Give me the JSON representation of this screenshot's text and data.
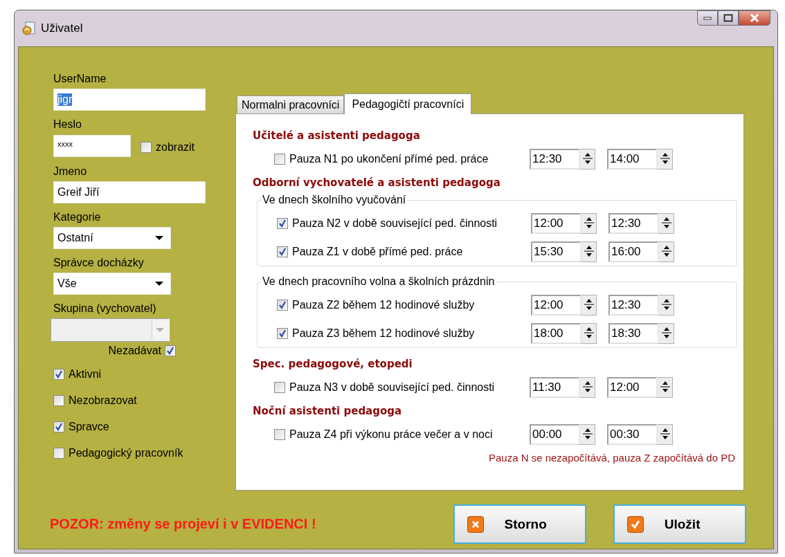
{
  "window": {
    "title": "Uživatel"
  },
  "fields": [
    {
      "kind": "text",
      "label": "UserName",
      "value": "jigr",
      "text_selected": true
    },
    {
      "kind": "password",
      "label": "Heslo",
      "value": "xxxx",
      "toggle": {
        "label": "zobrazit",
        "checked": false
      }
    },
    {
      "kind": "text",
      "label": "Jmeno",
      "value": "Greif Jiří",
      "text_selected": false
    },
    {
      "kind": "dropdown",
      "label": "Kategorie",
      "value": "Ostatní",
      "disabled": false
    },
    {
      "kind": "dropdown",
      "label": "Správce docházky",
      "value": "Vše",
      "disabled": false
    },
    {
      "kind": "dropdown",
      "label": "Skupina (vychovatel)",
      "disabled": true
    }
  ],
  "nezadavat": {
    "label": "Nezadávat",
    "checked": true
  },
  "options": [
    {
      "label": "Aktivni",
      "checked": true
    },
    {
      "label": "Nezobrazovat",
      "checked": false
    },
    {
      "label": "Spravce",
      "checked": true
    },
    {
      "label": "Pedagogický pracovník",
      "checked": false
    }
  ],
  "tabs": [
    {
      "label": "Normalni pracovníci",
      "selected": false
    },
    {
      "label": "Pedagogičtí pracovníci",
      "selected": true
    }
  ],
  "sections": [
    {
      "kind": "heading",
      "text": "Učitelé a asistenti pedagoga"
    },
    {
      "kind": "row",
      "label": "Pauza N1 po ukončení přímé ped. práce",
      "checked": false,
      "from": "12:30",
      "to": "14:00"
    },
    {
      "kind": "heading",
      "text": "Odborní vychovatelé a asistenti pedagoga"
    },
    {
      "kind": "group",
      "title": "Ve dnech školního vyučování",
      "rows": [
        {
          "label": "Pauza N2 v době související ped. činnosti",
          "checked": true,
          "from": "12:00",
          "to": "12:30"
        },
        {
          "label": "Pauza Z1 v době přímé ped. práce",
          "checked": true,
          "from": "15:30",
          "to": "16:00"
        }
      ]
    },
    {
      "kind": "group",
      "title": "Ve dnech pracovního volna a školních prázdnin",
      "rows": [
        {
          "label": "Pauza Z2 během 12 hodinové služby",
          "checked": true,
          "from": "12:00",
          "to": "12:30"
        },
        {
          "label": "Pauza Z3 během 12 hodinové služby",
          "checked": true,
          "from": "18:00",
          "to": "18:30"
        }
      ]
    },
    {
      "kind": "heading",
      "text": "Spec. pedagogové, etopedi"
    },
    {
      "kind": "row",
      "label": "Pauza N3 v době související ped. činnosti",
      "checked": false,
      "from": "11:30",
      "to": "12:00"
    },
    {
      "kind": "heading",
      "text": "Noční asistenti pedagoga"
    },
    {
      "kind": "row",
      "label": "Pauza Z4 při výkonu práce večer a v noci",
      "checked": false,
      "from": "00:00",
      "to": "00:30"
    }
  ],
  "note": "Pauza N se nezapočítává, pauza Z započítává do PD",
  "warning": "POZOR: změny se projeví i v EVIDENCI !",
  "buttons": [
    {
      "kind": "cancel",
      "label": "Storno"
    },
    {
      "kind": "save",
      "label": "Uložit"
    }
  ]
}
